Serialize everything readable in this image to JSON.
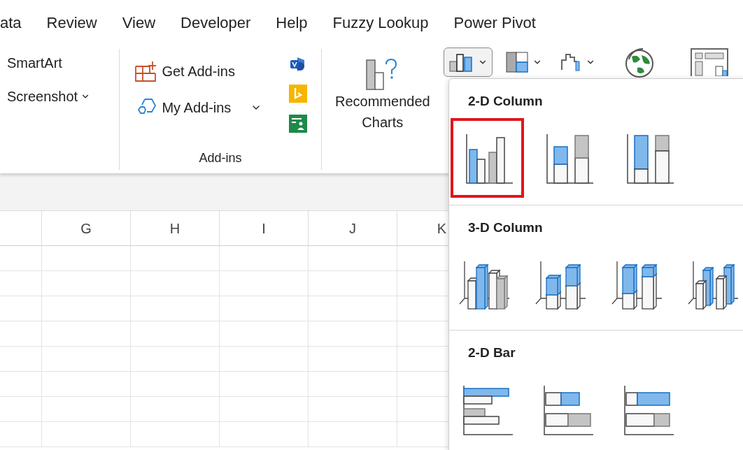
{
  "menu_tabs": [
    "ata",
    "Review",
    "View",
    "Developer",
    "Help",
    "Fuzzy Lookup",
    "Power Pivot"
  ],
  "ribbon": {
    "insert_items": [
      {
        "label": "SmartArt",
        "dropdown": false
      },
      {
        "label": "Screenshot",
        "dropdown": true
      }
    ],
    "addins_group": {
      "label": "Add-ins",
      "buttons": [
        {
          "label": "Get Add-ins",
          "kind": "get",
          "dropdown": false
        },
        {
          "label": "My Add-ins",
          "kind": "my",
          "dropdown": true
        }
      ],
      "small_icons": [
        {
          "kind": "visio"
        },
        {
          "kind": "bing"
        },
        {
          "kind": "people-graph"
        }
      ]
    },
    "recommended_charts": {
      "label": "Recommended Charts"
    },
    "chart_buttons": [
      {
        "kind": "column",
        "selected": true,
        "dropdown": true
      },
      {
        "kind": "hierarchy",
        "selected": false,
        "dropdown": true
      },
      {
        "kind": "waterfall",
        "selected": false,
        "dropdown": true
      },
      {
        "kind": "map",
        "selected": false,
        "dropdown": false
      },
      {
        "kind": "pivot",
        "selected": false,
        "dropdown": false
      }
    ]
  },
  "sheet": {
    "columns": [
      "G",
      "H",
      "I",
      "J",
      "K"
    ]
  },
  "chart_gallery": {
    "sections": [
      {
        "title": "2-D Column",
        "options": [
          {
            "kind": "clustered",
            "selected": true
          },
          {
            "kind": "stacked",
            "selected": false
          },
          {
            "kind": "percent",
            "selected": false
          }
        ]
      },
      {
        "title": "3-D Column",
        "options": [
          {
            "kind": "clustered3d",
            "selected": false
          },
          {
            "kind": "stacked3d",
            "selected": false
          },
          {
            "kind": "percent3d",
            "selected": false
          },
          {
            "kind": "column3d",
            "selected": false
          }
        ]
      },
      {
        "title": "2-D Bar",
        "options": [
          {
            "kind": "clusteredbar",
            "selected": false
          },
          {
            "kind": "stackedbar",
            "selected": false
          },
          {
            "kind": "percentbar",
            "selected": false
          }
        ]
      }
    ]
  }
}
